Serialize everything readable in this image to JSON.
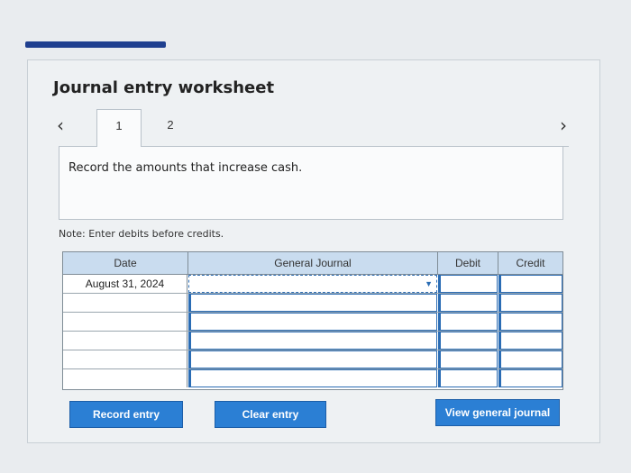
{
  "page": {
    "title": "Journal entry worksheet",
    "nav": {
      "prev_icon": "‹",
      "next_icon": "›"
    },
    "tabs": [
      {
        "label": "1",
        "active": true
      },
      {
        "label": "2",
        "active": false
      }
    ],
    "instruction": "Record the amounts that increase cash.",
    "note": "Note: Enter debits before credits."
  },
  "journal": {
    "headers": {
      "date": "Date",
      "general_journal": "General Journal",
      "debit": "Debit",
      "credit": "Credit"
    },
    "rows": [
      {
        "date": "August 31, 2024",
        "account": "",
        "debit": "",
        "credit": ""
      },
      {
        "date": "",
        "account": "",
        "debit": "",
        "credit": ""
      },
      {
        "date": "",
        "account": "",
        "debit": "",
        "credit": ""
      },
      {
        "date": "",
        "account": "",
        "debit": "",
        "credit": ""
      },
      {
        "date": "",
        "account": "",
        "debit": "",
        "credit": ""
      },
      {
        "date": "",
        "account": "",
        "debit": "",
        "credit": ""
      }
    ]
  },
  "buttons": {
    "record": "Record entry",
    "clear": "Clear entry",
    "view": "View general journal"
  },
  "colors": {
    "accent": "#2b7fd4",
    "header_bg": "#c9dcef",
    "top_bar": "#1f3f8f"
  }
}
